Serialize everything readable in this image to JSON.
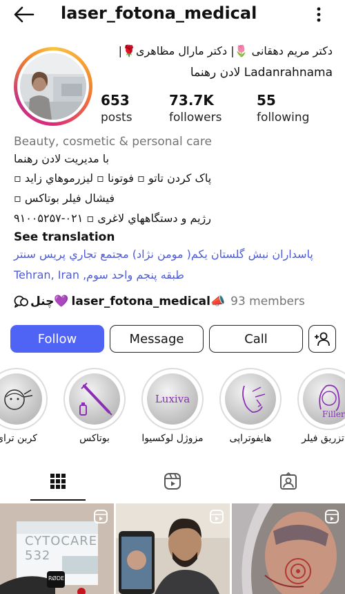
{
  "header": {
    "username": "laser_fotona_medical"
  },
  "bio": {
    "name_line1": "دکتر مریم دهقانی 🌷| دکتر مارال مظاهری🌹|",
    "name_line2": "Ladanrahnama لادن رهنما",
    "category": "Beauty, cosmetic & personal care",
    "lines": [
      "با مدیریت لادن رهنما",
      "پاک کردن تاتو ▫ فوتونا ▫ لیزرموهاي زايد ▫",
      "فیشال فیلر بوتاکس ▫",
      "رژیم و دستگاههاي لاغری ▫ ۰۲۱-۹۱۰۰۵۲۵۷"
    ],
    "see_translation": "See translation",
    "address_line1": "پاسداران نبش گلستان یکم( مومن نژاد) مجتمع تجاري پریس سنتر",
    "address_line2": "طبقه پنجم واحد سوم, Tehran, Iran"
  },
  "stats": {
    "posts": {
      "value": "653",
      "label": "posts"
    },
    "followers": {
      "value": "73.7K",
      "label": "followers"
    },
    "following": {
      "value": "55",
      "label": "following"
    }
  },
  "channel": {
    "prefix": "چنل💜",
    "name": "laser_fotona_medical📣",
    "members": "93 members"
  },
  "buttons": {
    "follow": "Follow",
    "message": "Message",
    "call": "Call"
  },
  "highlights": [
    {
      "label": "کربن ترای",
      "inner_text": ""
    },
    {
      "label": "بوتاکس",
      "inner_text": ""
    },
    {
      "label": "مزوژل لوکسیوا",
      "inner_text": "Luxiva"
    },
    {
      "label": "هایفوتراپی",
      "inner_text": ""
    },
    {
      "label": "تزریق فیلر",
      "inner_text": "Filler"
    }
  ],
  "posts": [
    {
      "caption": "CYTOCARE 532",
      "brand": "RØDE"
    },
    {
      "caption": ""
    },
    {
      "caption": ""
    }
  ],
  "colors": {
    "accent": "#4f64f5",
    "link": "#4d5bd5",
    "muted": "#737373",
    "highlight_purple": "#8a2fb5"
  }
}
